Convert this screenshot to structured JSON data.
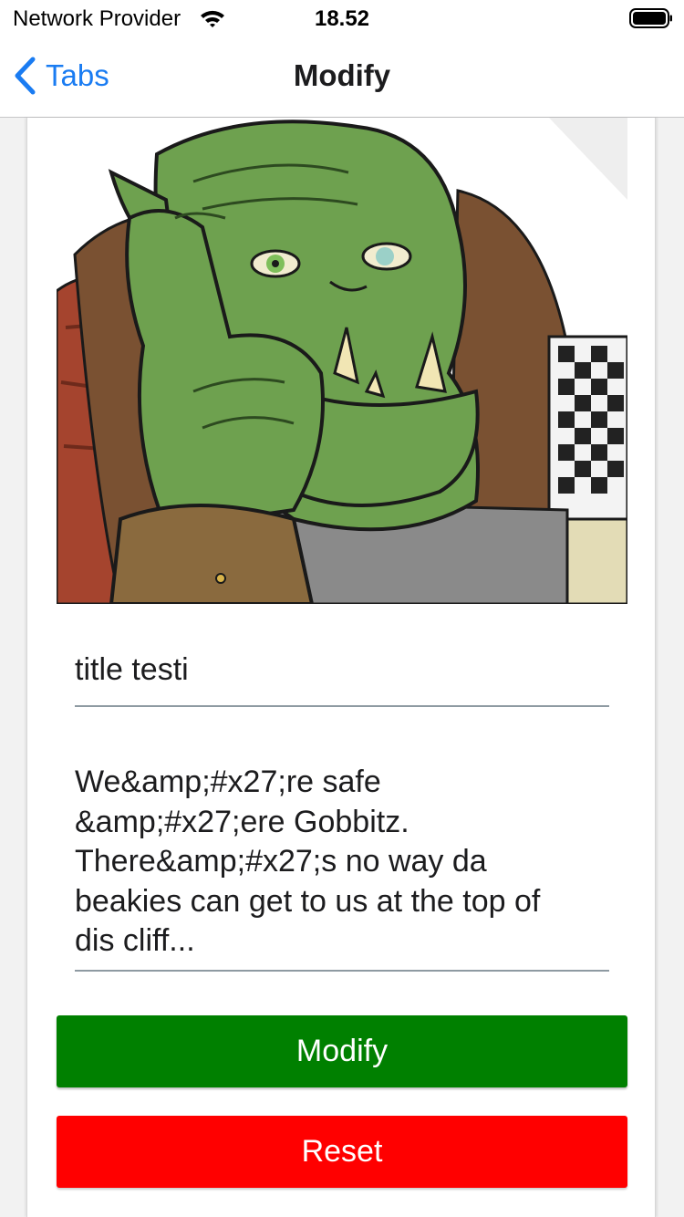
{
  "status_bar": {
    "carrier": "Network Provider",
    "time": "18.52",
    "wifi_icon": "wifi-icon",
    "battery_icon": "battery-full-icon"
  },
  "nav": {
    "back_label": "Tabs",
    "back_icon": "chevron-left-icon",
    "title": "Modify"
  },
  "form": {
    "image_subject": "green-orc-illustration",
    "title_value": "title testi",
    "body_value": "We&amp;#x27;re safe\n&amp;#x27;ere Gobbitz.\nThere&amp;#x27;s no way da\nbeakies can get to us at the top of\ndis cliff...",
    "modify_label": "Modify",
    "reset_label": "Reset"
  },
  "colors": {
    "accent": "#1a7cf2",
    "modify_button": "#008000",
    "reset_button": "#ff0000"
  }
}
